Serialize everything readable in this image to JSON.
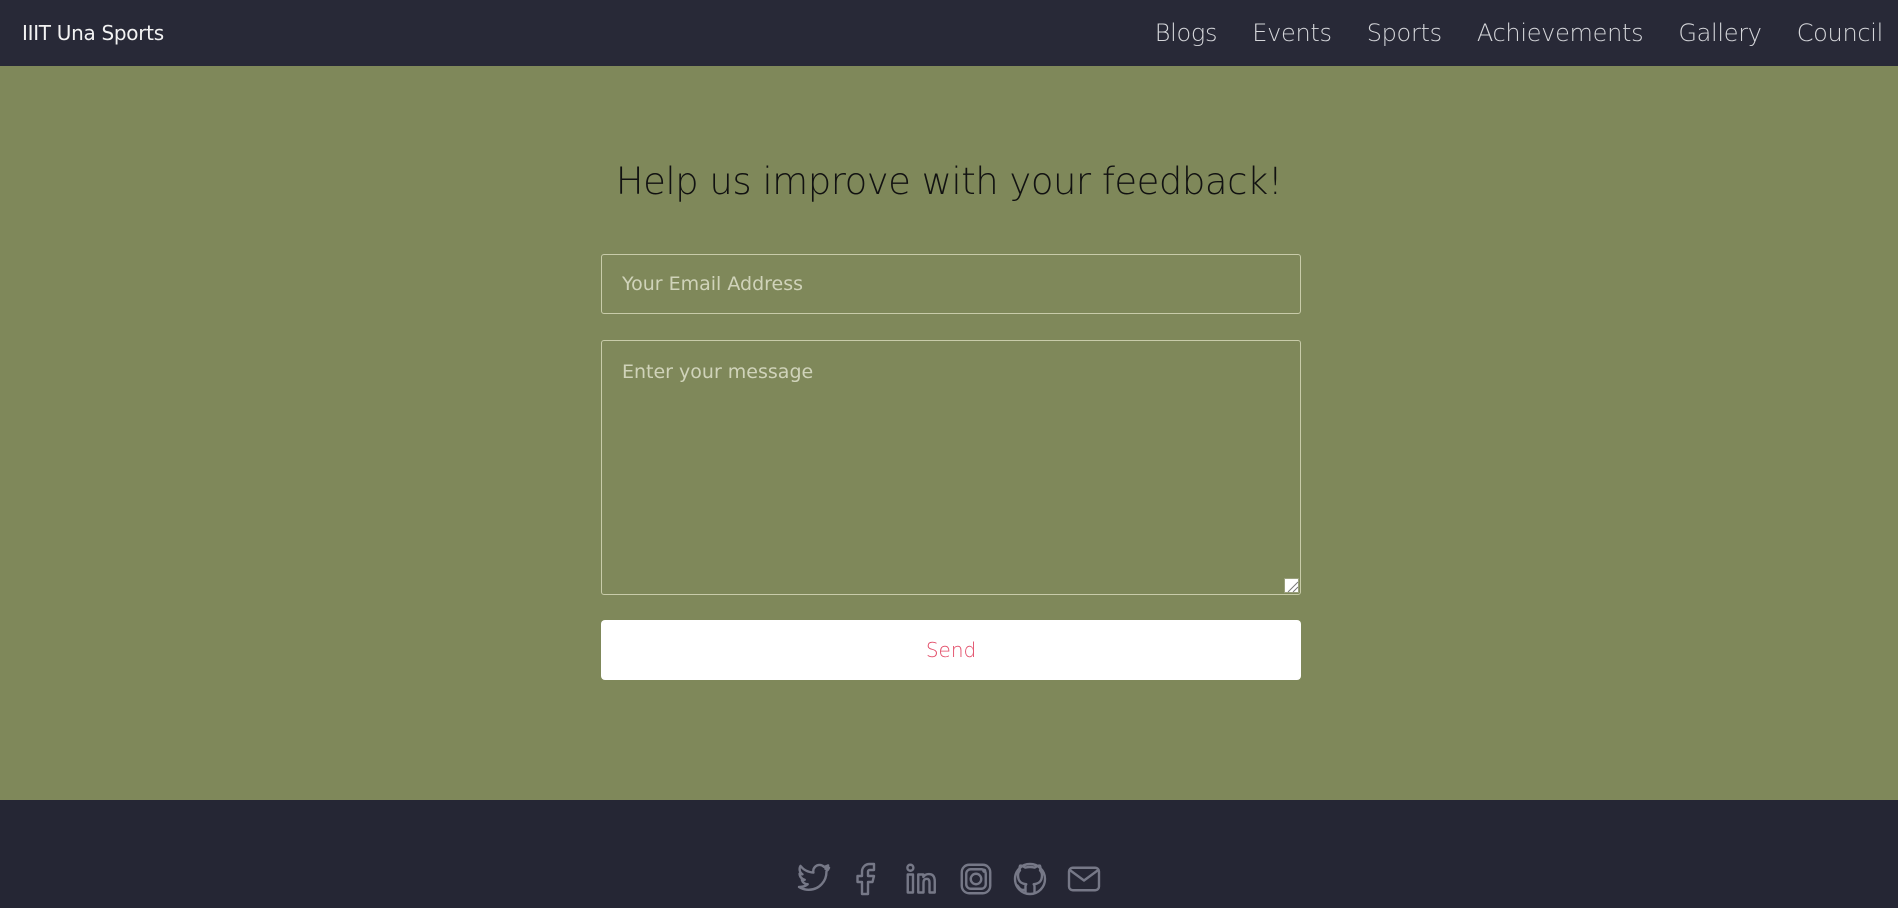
{
  "navbar": {
    "brand": "IIIT Una Sports",
    "links": [
      "Blogs",
      "Events",
      "Sports",
      "Achievements",
      "Gallery",
      "Council"
    ]
  },
  "feedback": {
    "title": "Help us improve with your feedback!",
    "email_placeholder": "Your Email Address",
    "email_value": "",
    "message_placeholder": "Enter your message",
    "message_value": "",
    "send_label": "Send"
  },
  "footer": {
    "social_icons": [
      "twitter-icon",
      "facebook-icon",
      "linkedin-icon",
      "instagram-icon",
      "github-icon",
      "mail-icon"
    ]
  },
  "colors": {
    "nav_bg": "#282937",
    "main_bg": "#7f885a",
    "footer_bg": "#252634",
    "send_text": "#e24a66"
  }
}
